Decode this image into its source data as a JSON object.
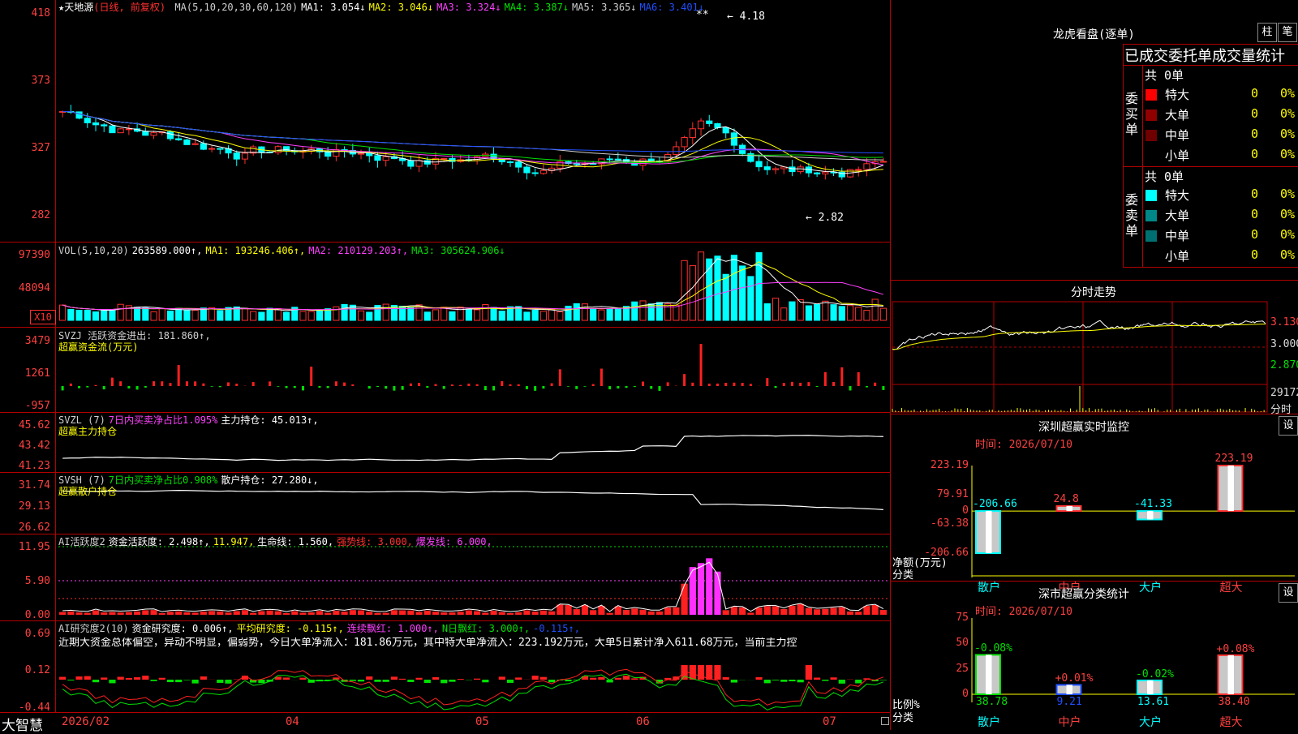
{
  "app": {
    "logo": "大智慧"
  },
  "main": {
    "title_star": "★",
    "stock_name": "天地源",
    "period": "(日线, 前复权)",
    "ma_header": [
      {
        "label": "MA(5,10,20,30,60,120)",
        "color": "#d0d0d0"
      },
      {
        "label": "MA1: 3.054↓",
        "color": "#ffffff"
      },
      {
        "label": "MA2: 3.046↓",
        "color": "#ffff00"
      },
      {
        "label": "MA3: 3.324↓",
        "color": "#ff40ff"
      },
      {
        "label": "MA4: 3.387↓",
        "color": "#00e000"
      },
      {
        "label": "MA5: 3.365↓",
        "color": "#d0d0d0"
      },
      {
        "label": "MA6: 3.401↓",
        "color": "#2050ff"
      }
    ],
    "y_ticks": [
      "418",
      "373",
      "327",
      "282"
    ],
    "high_label": "4.18",
    "low_label": "2.82",
    "stars": "**"
  },
  "vol": {
    "header": [
      {
        "label": "VOL(5,10,20)",
        "color": "#d0d0d0"
      },
      {
        "label": "263589.000↑,",
        "color": "#ffffff"
      },
      {
        "label": "MA1: 193246.406↑,",
        "color": "#ffff00"
      },
      {
        "label": "MA2: 210129.203↑,",
        "color": "#ff40ff"
      },
      {
        "label": "MA3: 305624.906↓",
        "color": "#00e000"
      }
    ],
    "y_ticks": [
      "97390",
      "48094"
    ],
    "unit_badge": "X10"
  },
  "svzj": {
    "header": [
      {
        "label": "SVZJ  活跃资金进出: 181.860↑,",
        "color": "#d0d0d0"
      }
    ],
    "sub": "超赢资金流(万元)",
    "y_ticks": [
      "3479",
      "1261",
      "-957"
    ]
  },
  "svzl": {
    "header": [
      {
        "label": "SVZL (7)",
        "color": "#d0d0d0"
      },
      {
        "label": "7日内买卖净占比1.095%",
        "color": "#ff40ff"
      },
      {
        "label": "主力持仓: 45.013↑,",
        "color": "#ffffff"
      }
    ],
    "sub": "超赢主力持仓",
    "y_ticks": [
      "45.62",
      "43.42",
      "41.23"
    ]
  },
  "svsh": {
    "header": [
      {
        "label": "SVSH (7)",
        "color": "#d0d0d0"
      },
      {
        "label": "7日内买卖净占比0.908%",
        "color": "#00e000"
      },
      {
        "label": "散户持仓: 27.280↓,",
        "color": "#ffffff"
      }
    ],
    "sub": "超赢散户持仓",
    "y_ticks": [
      "31.74",
      "29.13",
      "26.62"
    ]
  },
  "ai_active": {
    "header": [
      {
        "label": "AI活跃度2",
        "color": "#d0d0d0"
      },
      {
        "label": "资金活跃度: 2.498↑,",
        "color": "#ffffff"
      },
      {
        "label": "11.947,",
        "color": "#ffff00"
      },
      {
        "label": "生命线: 1.560,",
        "color": "#ffffff"
      },
      {
        "label": "强势线: 3.000,",
        "color": "#ff3030"
      },
      {
        "label": "爆发线: 6.000,",
        "color": "#ff40ff"
      }
    ],
    "y_ticks": [
      "11.95",
      "5.90",
      "0.00"
    ]
  },
  "ai_research": {
    "header": [
      {
        "label": "AI研究度2(10)",
        "color": "#d0d0d0"
      },
      {
        "label": "资金研究度: 0.006↑,",
        "color": "#ffffff"
      },
      {
        "label": "平均研究度: -0.115↑,",
        "color": "#ffff00"
      },
      {
        "label": "连续飘红: 1.000↑,",
        "color": "#ff40ff"
      },
      {
        "label": "N日飘红: 3.000↑,",
        "color": "#00e000"
      },
      {
        "label": "-0.115↑,",
        "color": "#2050ff"
      }
    ],
    "comment": "近期大资金总体偏空，异动不明显，偏弱势，今日大单净流入：181.86万元，其中特大单净流入：223.192万元，大单5日累计净入611.68万元，当前主力控",
    "y_ticks": [
      "0.69",
      "0.12",
      "-0.44"
    ]
  },
  "x_axis": {
    "labels": [
      "2026/02",
      "04",
      "05",
      "06",
      "07"
    ]
  },
  "dragon": {
    "title": "龙虎看盘(逐单)",
    "btn_column": "柱",
    "btn_stroke": "笔",
    "subtitle": "已成交委托单成交量统计",
    "buy_label": "委买单",
    "sell_label": "委卖单",
    "buy_total": "共 0单",
    "sell_total": "共 0单",
    "buy_rows": [
      {
        "name": "特大",
        "count": "0",
        "pct": "0%",
        "color": "#ff0000"
      },
      {
        "name": "大单",
        "count": "0",
        "pct": "0%",
        "color": "#900000"
      },
      {
        "name": "中单",
        "count": "0",
        "pct": "0%",
        "color": "#700000"
      },
      {
        "name": "小单",
        "count": "0",
        "pct": "0%",
        "color": "#000000"
      }
    ],
    "sell_rows": [
      {
        "name": "特大",
        "count": "0",
        "pct": "0%",
        "color": "#00ffff"
      },
      {
        "name": "大单",
        "count": "0",
        "pct": "0%",
        "color": "#008888"
      },
      {
        "name": "中单",
        "count": "0",
        "pct": "0%",
        "color": "#007070"
      },
      {
        "name": "小单",
        "count": "0",
        "pct": "0%",
        "color": "#000000"
      }
    ]
  },
  "intraday": {
    "title": "分时走势",
    "y_labels": [
      "3.130",
      "3.000",
      "2.870"
    ],
    "vol_label": "29172",
    "unit_label": "分时"
  },
  "monitor": {
    "title": "深圳超赢实时监控",
    "set_button": "设",
    "time": "时间: 2026/07/10",
    "y_ticks": [
      "223.19",
      "79.91",
      "0",
      "-63.38",
      "-206.66"
    ],
    "axis_title_1": "净额(万元)",
    "axis_title_2": "分类",
    "bars": [
      {
        "cat": "散户",
        "value": -206.66,
        "label": "-206.66"
      },
      {
        "cat": "中户",
        "value": 24.8,
        "label": "24.8"
      },
      {
        "cat": "大户",
        "value": -41.33,
        "label": "-41.33"
      },
      {
        "cat": "超大",
        "value": 223.19,
        "label": "223.19"
      }
    ]
  },
  "classify": {
    "title": "深市超赢分类统计",
    "set_button": "设",
    "time": "时间: 2026/07/10",
    "y_ticks": [
      "75",
      "50",
      "25",
      "0"
    ],
    "axis_title_1": "比例%",
    "axis_title_2": "分类",
    "bars": [
      {
        "cat": "散户",
        "value": 38.78,
        "label": "38.78",
        "delta": "-0.08%"
      },
      {
        "cat": "中户",
        "value": 9.21,
        "label": "9.21",
        "delta": "+0.01%"
      },
      {
        "cat": "大户",
        "value": 13.61,
        "label": "13.61",
        "delta": "-0.02%"
      },
      {
        "cat": "超大",
        "value": 38.4,
        "label": "38.40",
        "delta": "+0.08%"
      }
    ]
  },
  "chart_data": [
    {
      "type": "bar",
      "title": "深圳超赢实时监控",
      "categories": [
        "散户",
        "中户",
        "大户",
        "超大"
      ],
      "values": [
        -206.66,
        24.8,
        -41.33,
        223.19
      ],
      "ylabel": "净额(万元)",
      "xlabel": "分类",
      "ylim": [
        -206.66,
        223.19
      ]
    },
    {
      "type": "bar",
      "title": "深市超赢分类统计",
      "categories": [
        "散户",
        "中户",
        "大户",
        "超大"
      ],
      "values": [
        38.78,
        9.21,
        13.61,
        38.4
      ],
      "ylabel": "比例%",
      "xlabel": "分类",
      "ylim": [
        0,
        75
      ]
    }
  ]
}
